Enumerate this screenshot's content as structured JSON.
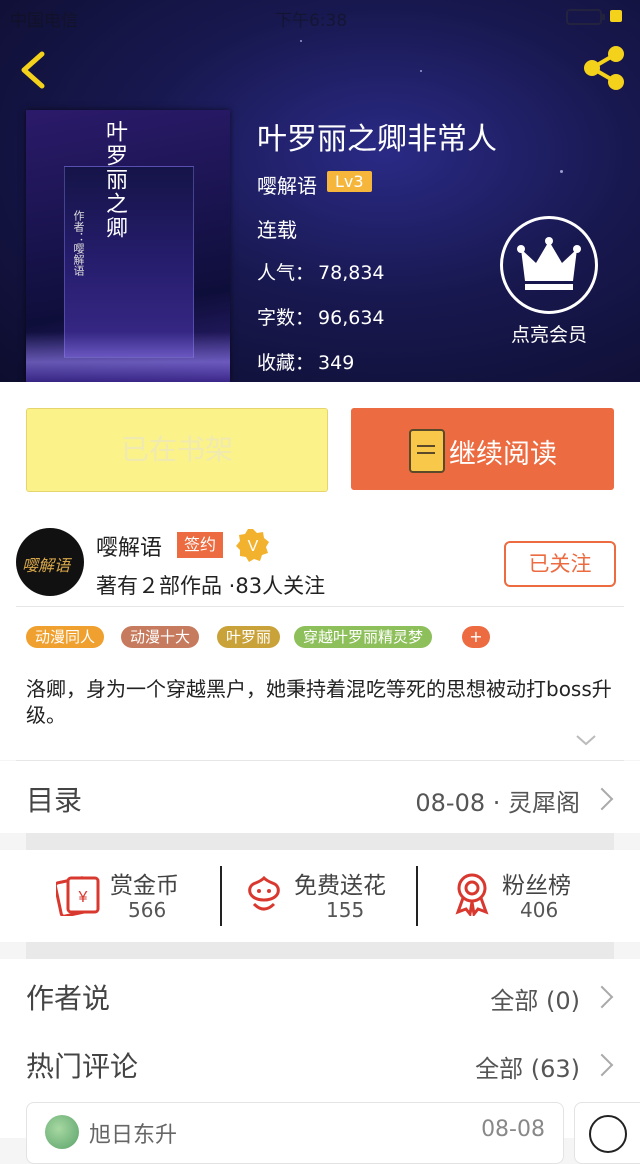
{
  "status_bar": {
    "carrier": "中国电信",
    "time": "下午6:38"
  },
  "book": {
    "title": "叶罗丽之卿非常人",
    "author": "嘤解语",
    "level": "Lv3",
    "state": "连载",
    "cover_title": "叶罗丽之卿",
    "cover_subtitle": "作者：嘤解语",
    "stats": [
      {
        "label": "人气：",
        "value": "78,834"
      },
      {
        "label": "字数：",
        "value": "96,634"
      },
      {
        "label": "收藏：",
        "value": "349"
      }
    ]
  },
  "vip": {
    "label": "点亮会员"
  },
  "actions": {
    "shelf_label": "已在书架",
    "read_label": "继续阅读"
  },
  "author_card": {
    "avatar_text": "嘤解语",
    "name": "嘤解语",
    "sign_badge": "签约",
    "v_badge": "V",
    "meta": "著有２部作品 ·83人关注",
    "follow_label": "已关注"
  },
  "tags": [
    {
      "label": "动漫同人",
      "color": "#f0a02e"
    },
    {
      "label": "动漫十大",
      "color": "#c77b5e"
    },
    {
      "label": "叶罗丽",
      "color": "#c9a23a"
    },
    {
      "label": "穿越叶罗丽精灵梦",
      "color": "#8dbf5a"
    }
  ],
  "tag_add": "+",
  "description": "洛卿，身为一个穿越黑户，她秉持着混吃等死的思想被动打boss升级。",
  "toc": {
    "title": "目录",
    "latest": "08-08 · 灵犀阁"
  },
  "support": [
    {
      "label": "赏金币",
      "value": "566",
      "icon": "coin-ticket-icon"
    },
    {
      "label": "免费送花",
      "value": "155",
      "icon": "flower-icon"
    },
    {
      "label": "粉丝榜",
      "value": "406",
      "icon": "medal-icon"
    }
  ],
  "author_says": {
    "title": "作者说",
    "right": "全部 (0)"
  },
  "hot_comments": {
    "title": "热门评论",
    "right": "全部 (63)",
    "first": {
      "name": "旭日东升",
      "date": "08-08"
    }
  },
  "colors": {
    "accent": "#ec6b40",
    "shelf_bg": "#fbf38a",
    "lv_badge": "#f5b63b"
  }
}
